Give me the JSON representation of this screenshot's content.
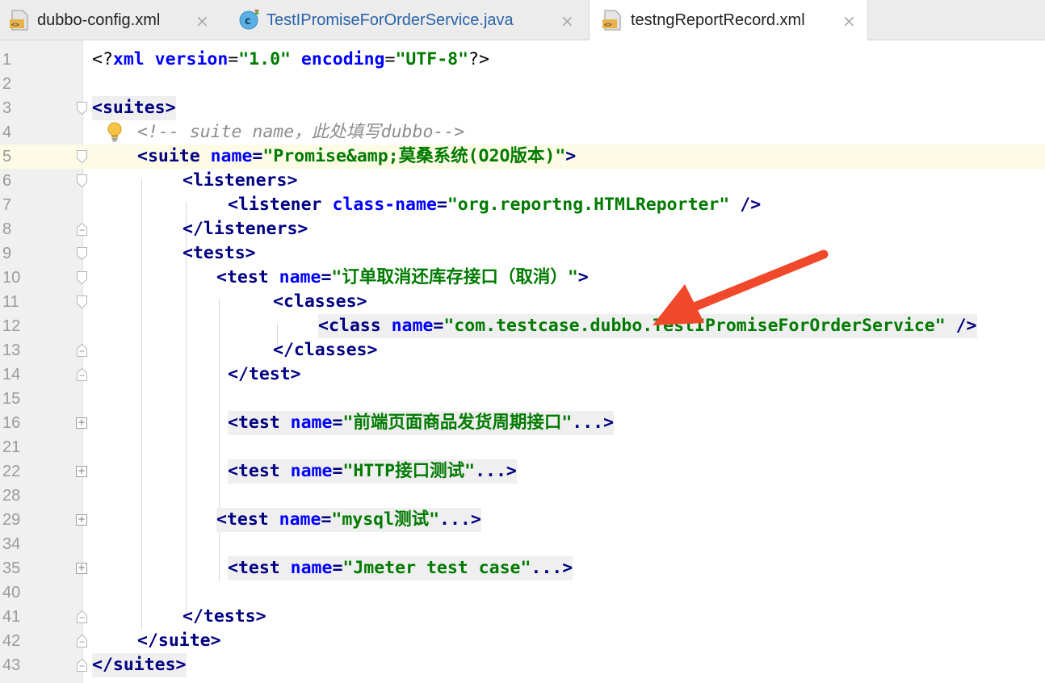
{
  "tabs": [
    {
      "label": "dubbo-config.xml",
      "icon": "xml-file-icon",
      "active": false
    },
    {
      "label": "TestIPromiseForOrderService.java",
      "icon": "java-class-icon",
      "active": false
    },
    {
      "label": "testngReportRecord.xml",
      "icon": "xml-file-icon",
      "active": true
    }
  ],
  "close_glyph": "×",
  "editor": {
    "current_line": "5",
    "lines": [
      {
        "n": "1",
        "parts": [
          "<?",
          "xml ",
          "version",
          "=",
          "\"1.0\"",
          " ",
          "encoding",
          "=",
          "\"UTF-8\"",
          "?>"
        ]
      },
      {
        "n": "2"
      },
      {
        "n": "3",
        "parts": [
          "<suites>"
        ]
      },
      {
        "n": "4",
        "parts": [
          "<!-- suite name，此处填写dubbo-->"
        ]
      },
      {
        "n": "5",
        "parts": [
          "<suite ",
          "name",
          "=",
          "\"Promise&amp;莫桑系统(O2O版本)\"",
          ">"
        ]
      },
      {
        "n": "6",
        "parts": [
          "<listeners>"
        ]
      },
      {
        "n": "7",
        "parts": [
          "<listener ",
          "class-name",
          "=",
          "\"org.reportng.HTMLReporter\"",
          " />"
        ]
      },
      {
        "n": "8",
        "parts": [
          "</listeners>"
        ]
      },
      {
        "n": "9",
        "parts": [
          "<tests>"
        ]
      },
      {
        "n": "10",
        "parts": [
          "<test ",
          "name",
          "=",
          "\"订单取消还库存接口（取消）\"",
          ">"
        ]
      },
      {
        "n": "11",
        "parts": [
          "<classes>"
        ]
      },
      {
        "n": "12",
        "parts": [
          "<class ",
          "name",
          "=",
          "\"com.testcase.dubbo.TestIPromiseForOrderService\"",
          " />"
        ]
      },
      {
        "n": "13",
        "parts": [
          "</classes>"
        ]
      },
      {
        "n": "14",
        "parts": [
          "</test>"
        ]
      },
      {
        "n": "15"
      },
      {
        "n": "16",
        "parts": [
          "<test ",
          "name",
          "=",
          "\"前端页面商品发货周期接口\"",
          "...>"
        ]
      },
      {
        "n": "21"
      },
      {
        "n": "22",
        "parts": [
          "<test ",
          "name",
          "=",
          "\"HTTP接口测试\"",
          "...>"
        ]
      },
      {
        "n": "28"
      },
      {
        "n": "29",
        "parts": [
          "<test ",
          "name",
          "=",
          "\"mysql测试\"",
          "...>"
        ]
      },
      {
        "n": "34"
      },
      {
        "n": "35",
        "parts": [
          "<test ",
          "name",
          "=",
          "\"Jmeter test case\"",
          "...>"
        ]
      },
      {
        "n": "40"
      },
      {
        "n": "41",
        "parts": [
          "</tests>"
        ]
      },
      {
        "n": "42",
        "parts": [
          "</suite>"
        ]
      },
      {
        "n": "43",
        "parts": [
          "</suites>"
        ]
      }
    ]
  },
  "colors": {
    "tag": "#000080",
    "attribute": "#0000ff",
    "value": "#007a00",
    "comment": "#8c8c8c",
    "current_line_bg": "#fdfbe6",
    "arrow": "#f0482b"
  }
}
